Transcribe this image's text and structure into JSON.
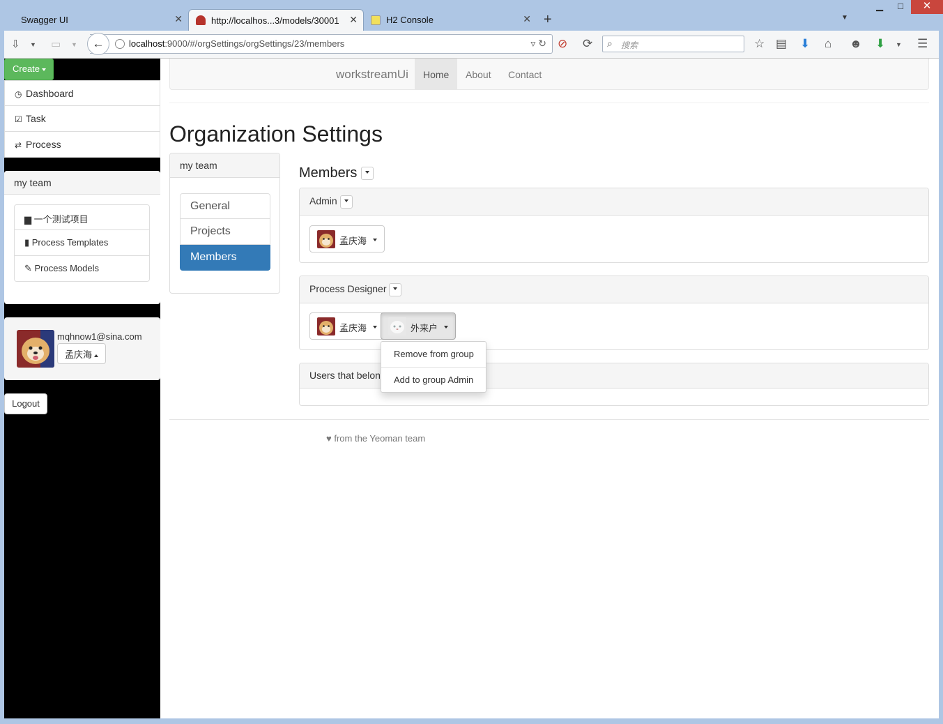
{
  "browser": {
    "tabs": [
      {
        "title": "Swagger UI",
        "favicon_color": "#85ea2d"
      },
      {
        "title": "http://localhos...3/models/30001",
        "favicon_color": "#b6332c"
      },
      {
        "title": "H2 Console",
        "favicon_color": "#f2e05c"
      }
    ],
    "url": {
      "host": "localhost",
      "rest": ":9000/#/orgSettings/orgSettings/23/members"
    },
    "search_placeholder": "搜索"
  },
  "app": {
    "create_label": "Create",
    "sidebar_menu": [
      {
        "label": "Dashboard",
        "icon": "clock-icon"
      },
      {
        "label": "Task",
        "icon": "check-icon"
      },
      {
        "label": "Process",
        "icon": "retweet-icon"
      }
    ],
    "team_panel": {
      "title": "my team",
      "items": [
        {
          "label": "一个测试项目",
          "icon": "briefcase-icon"
        },
        {
          "label": "Process Templates",
          "icon": "file-icon"
        },
        {
          "label": "Process Models",
          "icon": "pencil-icon"
        }
      ]
    },
    "user": {
      "email": "mqhnow1@sina.com",
      "name": "孟庆海"
    },
    "logout_label": "Logout",
    "brand": "workstreamUi",
    "nav": [
      "Home",
      "About",
      "Contact"
    ],
    "page_title": "Organization Settings",
    "subpanel": {
      "title": "my team",
      "items": [
        "General",
        "Projects",
        "Members"
      ]
    },
    "members": {
      "heading": "Members",
      "groups": [
        {
          "name": "Admin",
          "members": [
            "孟庆海"
          ]
        },
        {
          "name": "Process Designer",
          "members": [
            "孟庆海",
            "外来户"
          ]
        },
        {
          "name": "Users that belon"
        }
      ]
    },
    "dropdown": [
      "Remove from group",
      "Add to group Admin"
    ],
    "footer": "from the Yeoman team"
  }
}
